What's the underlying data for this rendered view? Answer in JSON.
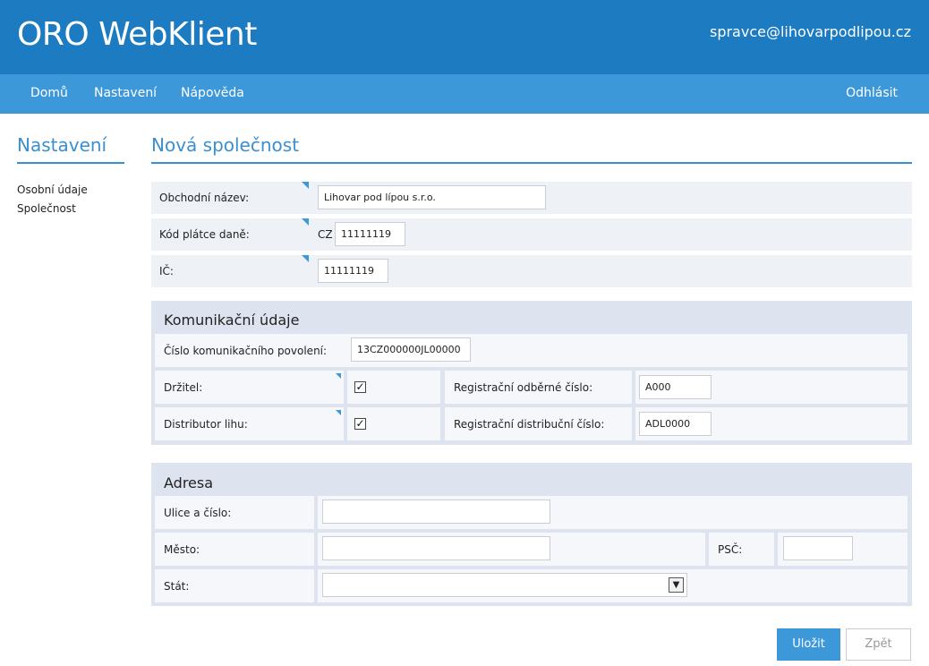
{
  "app": {
    "title": "ORO WebKlient",
    "user": "spravce@lihovarpodlipou.cz"
  },
  "nav": {
    "home": "Domů",
    "settings": "Nastavení",
    "help": "Nápověda",
    "logout": "Odhlásit"
  },
  "sidebar": {
    "title": "Nastavení",
    "items": [
      "Osobní údaje",
      "Společnost"
    ]
  },
  "page": {
    "title": "Nová společnost"
  },
  "company": {
    "name_label": "Obchodní název:",
    "name_value": "Lihovar pod lípou s.r.o.",
    "tax_label": "Kód plátce daně:",
    "tax_prefix": "CZ",
    "tax_value": "11111119",
    "ic_label": "IČ:",
    "ic_value": "11111119"
  },
  "communication": {
    "title": "Komunikační údaje",
    "permit_label": "Číslo komunikačního povolení:",
    "permit_value": "13CZ000000JL00000",
    "holder_label": "Držitel:",
    "holder_checked": true,
    "distributor_label": "Distributor lihu:",
    "distributor_checked": true,
    "reg_take_label": "Registrační odběrné číslo:",
    "reg_take_value": "A000",
    "reg_dist_label": "Registrační distribuční číslo:",
    "reg_dist_value": "ADL0000"
  },
  "address": {
    "title": "Adresa",
    "street_label": "Ulice a číslo:",
    "street_value": "",
    "city_label": "Město:",
    "city_value": "",
    "zip_label": "PSČ:",
    "zip_value": "",
    "country_label": "Stát:",
    "country_value": ""
  },
  "buttons": {
    "save": "Uložit",
    "back": "Zpět"
  },
  "colors": {
    "header": "#1c7bc1",
    "nav": "#3d98da",
    "accent": "#3a8fd0"
  }
}
